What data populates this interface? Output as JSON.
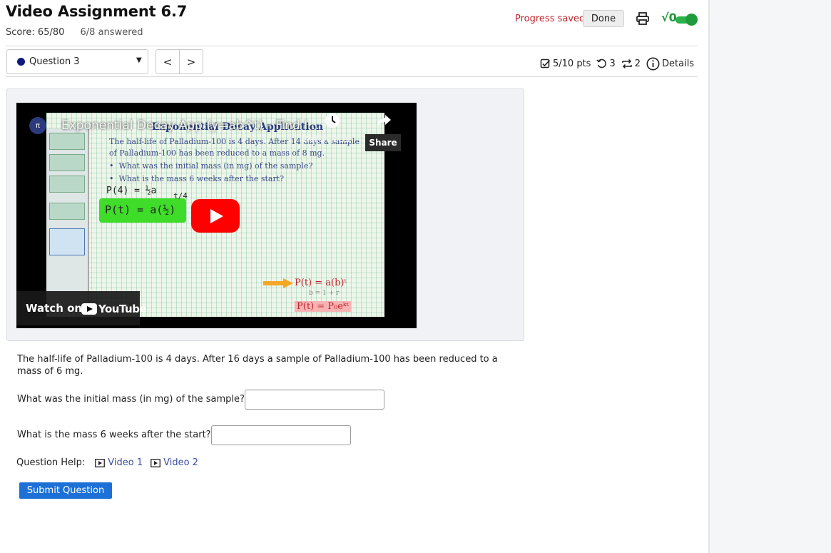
{
  "header": {
    "title": "Video Assignment 6.7",
    "score": "Score: 65/80",
    "answered": "6/8 answered",
    "progress_status": "Progress saved",
    "done_label": "Done",
    "print_icon": "printer-icon",
    "math_toggle_glyph": "√0",
    "math_toggle_on": true,
    "accent_color": "#1e9b3a"
  },
  "question_nav": {
    "selected": "Question 3",
    "prev": "<",
    "next": ">",
    "status_dot_color": "#0d1a7e"
  },
  "question_meta": {
    "points": "5/10 pts",
    "retries": "3",
    "attempts": "2",
    "details": "Details"
  },
  "video": {
    "title": "Exponential Decay App (y=ab^t) - Find I...",
    "board_title": "Exponential Decay Application",
    "board_line1": "The half-life of Palladium-100 is 4 days. After 14 days a sample",
    "board_line2": "of Palladium-100 has been reduced to a mass of 8 mg.",
    "board_bullet1": "What was the initial mass (in mg) of the sample?",
    "board_bullet2": "What is the mass 6 weeks after the start?",
    "hand1": "P(4) = ½a",
    "hand2": "P(t) = a(½)",
    "hand_exp": "t/4",
    "formula1": "P(t) = a(b)ᵗ",
    "formula_note": "b = 1 + r",
    "formula2": "P(t) = P₀eᵏᵗ",
    "watch_later": "Watch later",
    "share": "Share",
    "watch_on": "Watch on",
    "youtube": "YouTube",
    "play_color": "#ff0000"
  },
  "question": {
    "text": "The half-life of Palladium-100 is 4 days. After 16 days a sample of Palladium-100 has been reduced to a mass of 6 mg.",
    "prompt1": "What was the initial mass (in mg) of the sample?",
    "answer1_value": "",
    "prompt2": "What is the mass 6 weeks after the start?",
    "answer2_value": "",
    "help_label": "Question Help:",
    "help_video1": "Video 1",
    "help_video2": "Video 2",
    "submit_label": "Submit Question",
    "submit_color": "#1c70d6"
  }
}
